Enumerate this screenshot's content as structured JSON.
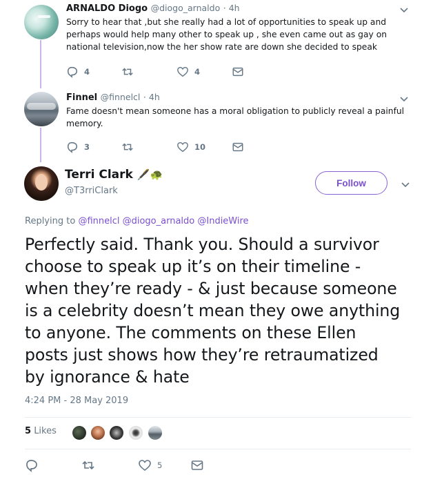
{
  "replies": [
    {
      "name": "ARNALDO Diogo",
      "handle": "@diogo_arnaldo",
      "time": "· 4h",
      "text_lines": [
        "Sorry to hear that ,but she really had a lot of opportunities to speak up and",
        "perhaps would help many other to speak up , she even came out as gay on",
        "national television,now the her show rate are down she decided to speak"
      ],
      "replies_count": "4",
      "retweets_count": "",
      "likes_count": "4"
    },
    {
      "name": "Finnel",
      "handle": "@finnelcl",
      "time": "· 4h",
      "text_lines": [
        "Fame doesn't mean someone has a moral obligation to publicly reveal a painful",
        "memory."
      ],
      "replies_count": "3",
      "retweets_count": "",
      "likes_count": "10"
    }
  ],
  "main_tweet": {
    "name": "Terri Clark",
    "name_emojis": "🖋️🐢",
    "handle": "@T3rriClark",
    "follow_label": "Follow",
    "replying_prefix": "Replying to",
    "replying_to": "@finnelcl @diogo_arnaldo @IndieWire",
    "text_lines": [
      "Perfectly said. Thank you. Should a survivor",
      "choose to speak up it’s on their timeline -",
      "when they’re ready - & just because someone",
      "is a celebrity doesn’t mean they owe anything",
      "to anyone. The comments on these Ellen",
      "posts just shows how they’re retraumatized",
      "by ignorance & hate"
    ],
    "timestamp": "4:24 PM - 28 May 2019",
    "likes_count": "5",
    "likes_label": "Likes",
    "bottom_likes": "5"
  },
  "colors": {
    "accent": "#7a4fd0",
    "thread_line": "#cbb4e8",
    "muted": "#657786"
  }
}
